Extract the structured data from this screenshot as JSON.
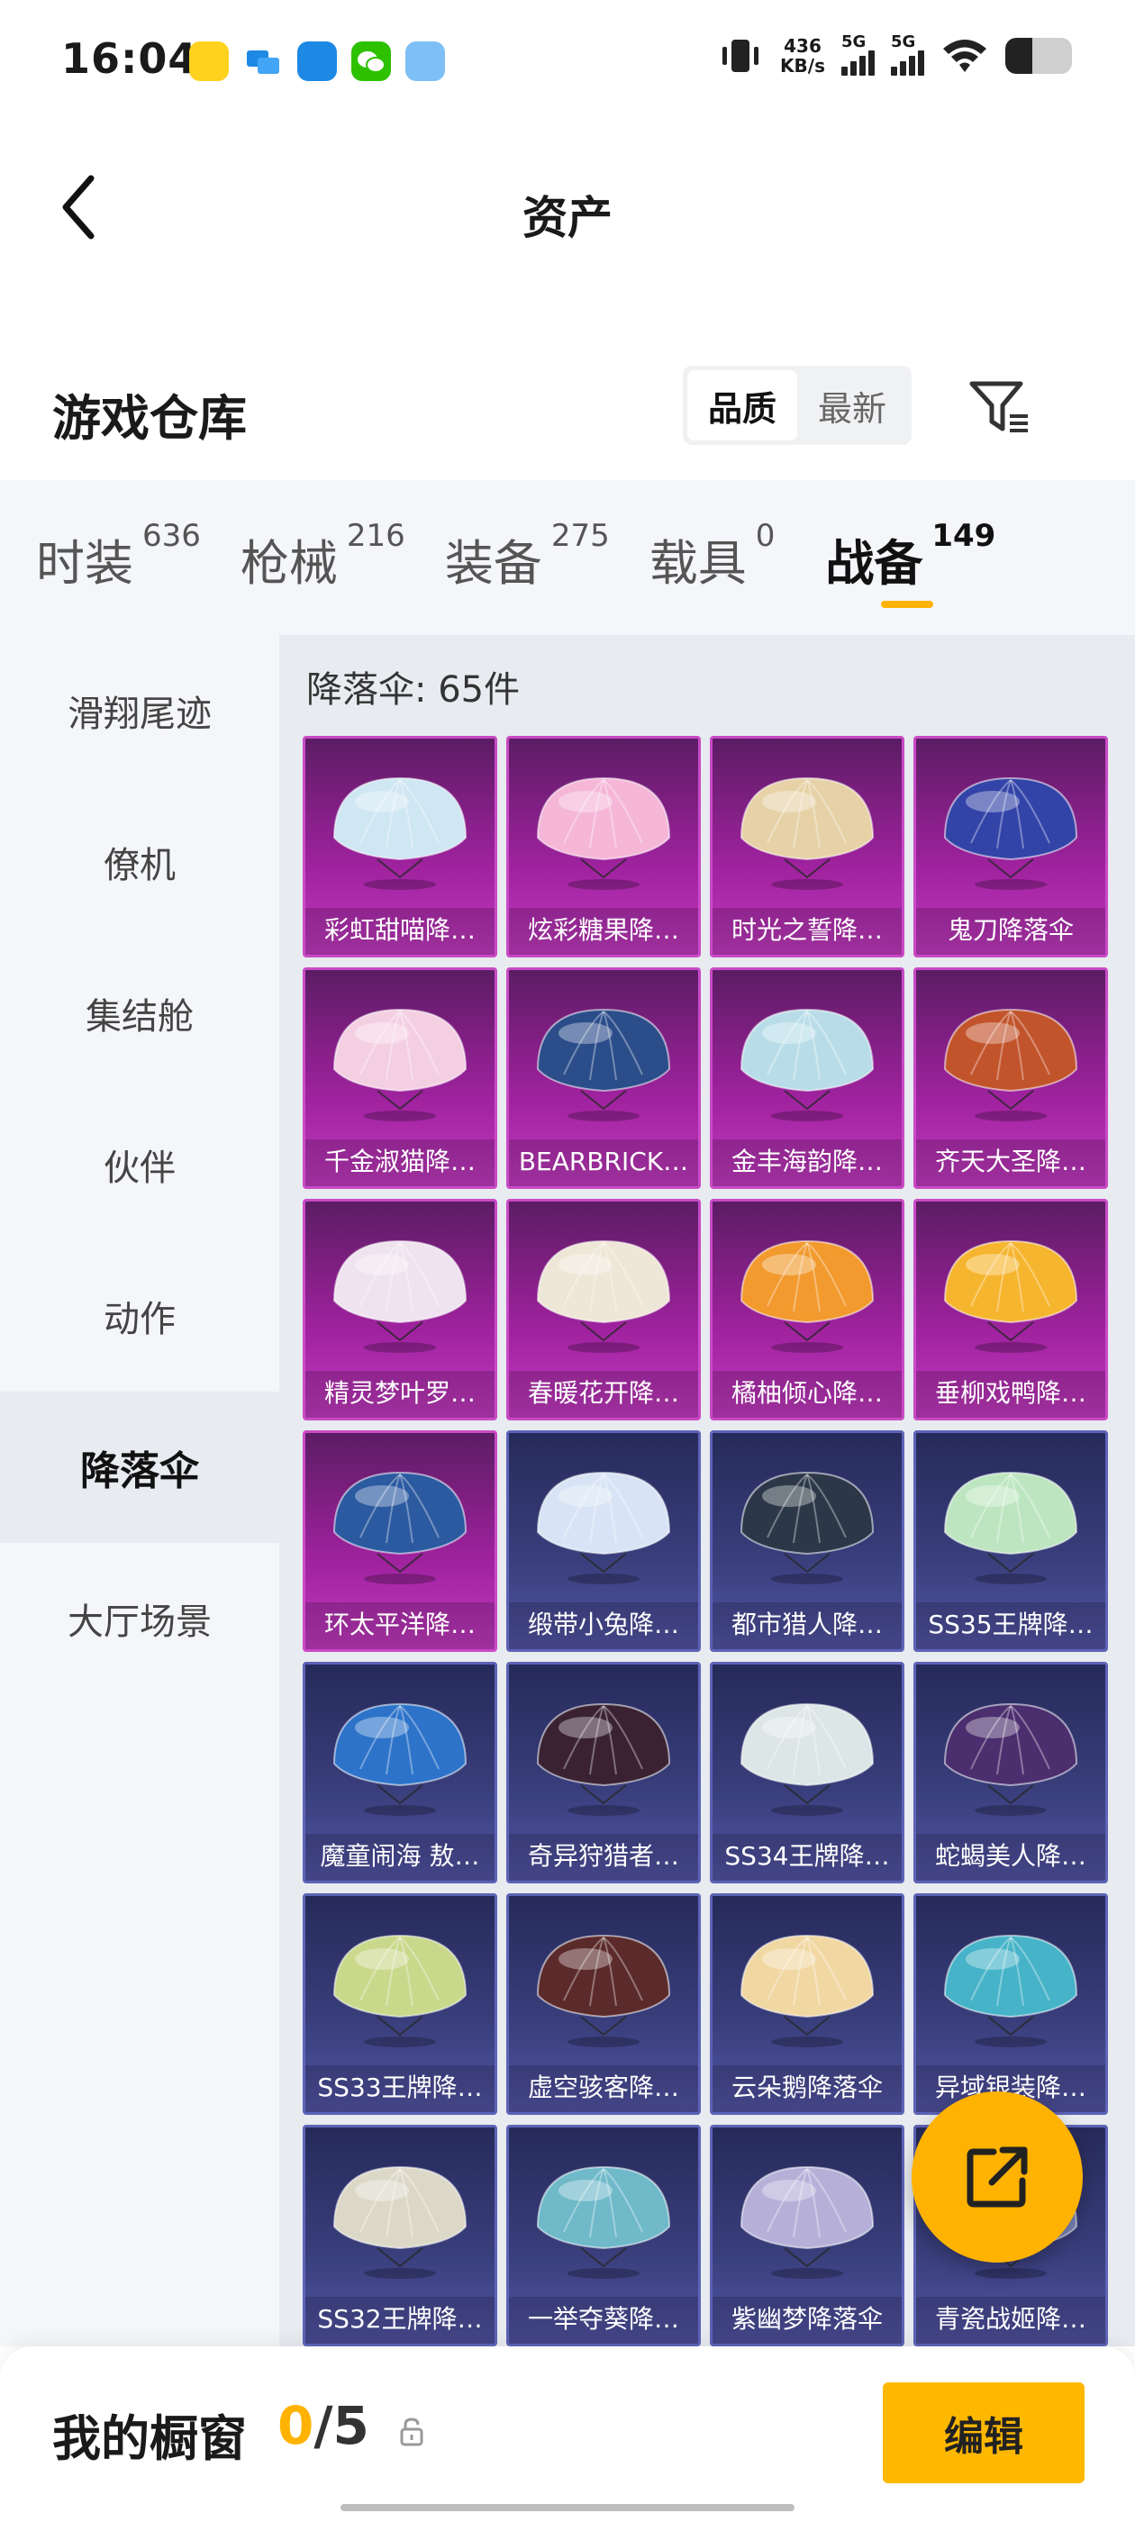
{
  "status_bar": {
    "time": "16:04",
    "net_speed_value": "436",
    "net_speed_unit": "KB/s",
    "signal1": "5G",
    "signal2": "5G",
    "app_icons": [
      "game-app-icon",
      "message-app-icon",
      "browser-app-icon",
      "wechat-icon",
      "assistant-app-icon"
    ],
    "battery_level": 0.4
  },
  "header": {
    "title": "资产"
  },
  "warehouse": {
    "title": "游戏仓库",
    "sort_options": [
      "品质",
      "最新"
    ],
    "sort_active": "品质"
  },
  "categories": [
    {
      "label": "时装",
      "count": "636"
    },
    {
      "label": "枪械",
      "count": "216"
    },
    {
      "label": "装备",
      "count": "275"
    },
    {
      "label": "载具",
      "count": "0"
    },
    {
      "label": "战备",
      "count": "149",
      "active": true
    }
  ],
  "sidebar": {
    "items": [
      "滑翔尾迹",
      "僚机",
      "集结舱",
      "伙伴",
      "动作",
      "降落伞",
      "大厅场景"
    ],
    "active": "降落伞"
  },
  "section": {
    "title": "降落伞: 65件"
  },
  "items": [
    {
      "name": "彩虹甜喵降…",
      "tier": "purple",
      "color": "#cfe6f3"
    },
    {
      "name": "炫彩糖果降…",
      "tier": "purple",
      "color": "#f5b6d8"
    },
    {
      "name": "时光之誓降…",
      "tier": "purple",
      "color": "#e6d2a6"
    },
    {
      "name": "鬼刀降落伞",
      "tier": "purple",
      "color": "#3344a8"
    },
    {
      "name": "千金淑猫降…",
      "tier": "purple",
      "color": "#f4cfe2"
    },
    {
      "name": "BEARBRICK…",
      "tier": "purple",
      "color": "#2b4d8a"
    },
    {
      "name": "金丰海韵降…",
      "tier": "purple",
      "color": "#b9dde8"
    },
    {
      "name": "齐天大圣降…",
      "tier": "purple",
      "color": "#c2542c"
    },
    {
      "name": "精灵梦叶罗…",
      "tier": "purple",
      "color": "#efe3ef"
    },
    {
      "name": "春暖花开降…",
      "tier": "purple",
      "color": "#eee6d6"
    },
    {
      "name": "橘柚倾心降…",
      "tier": "purple",
      "color": "#f29a2e"
    },
    {
      "name": "垂柳戏鸭降…",
      "tier": "purple",
      "color": "#f6b52e"
    },
    {
      "name": "环太平洋降…",
      "tier": "purple",
      "color": "#2b5aa0"
    },
    {
      "name": "缎带小兔降…",
      "tier": "blue",
      "color": "#d8e4f5"
    },
    {
      "name": "都市猎人降…",
      "tier": "blue",
      "color": "#2c3848"
    },
    {
      "name": "SS35王牌降…",
      "tier": "blue",
      "color": "#bde6c0"
    },
    {
      "name": "魔童闹海 敖…",
      "tier": "blue",
      "color": "#2d73c9"
    },
    {
      "name": "奇异狩猎者…",
      "tier": "blue",
      "color": "#3a2233"
    },
    {
      "name": "SS34王牌降…",
      "tier": "blue",
      "color": "#dde6e6"
    },
    {
      "name": "蛇蝎美人降…",
      "tier": "blue",
      "color": "#4b2e6e"
    },
    {
      "name": "SS33王牌降…",
      "tier": "blue",
      "color": "#c9d88a"
    },
    {
      "name": "虚空骇客降…",
      "tier": "blue",
      "color": "#5b2a2a"
    },
    {
      "name": "云朵鹅降落伞",
      "tier": "blue",
      "color": "#f1d7a2"
    },
    {
      "name": "异域银装降…",
      "tier": "blue",
      "color": "#46b3c8"
    },
    {
      "name": "SS32王牌降…",
      "tier": "blue",
      "color": "#dcd8c8"
    },
    {
      "name": "一举夺葵降…",
      "tier": "blue",
      "color": "#6fb9c9"
    },
    {
      "name": "紫幽梦降落伞",
      "tier": "blue",
      "color": "#b6b0d9"
    },
    {
      "name": "青瓷战姬降…",
      "tier": "blue",
      "color": "#7c86b8"
    }
  ],
  "showcase": {
    "title": "我的橱窗",
    "current": "0",
    "total": "/5",
    "edit_label": "编辑"
  },
  "colors": {
    "accent": "#ffb300",
    "purple_tier": "#a0229f",
    "blue_tier": "#3a3f7d"
  }
}
